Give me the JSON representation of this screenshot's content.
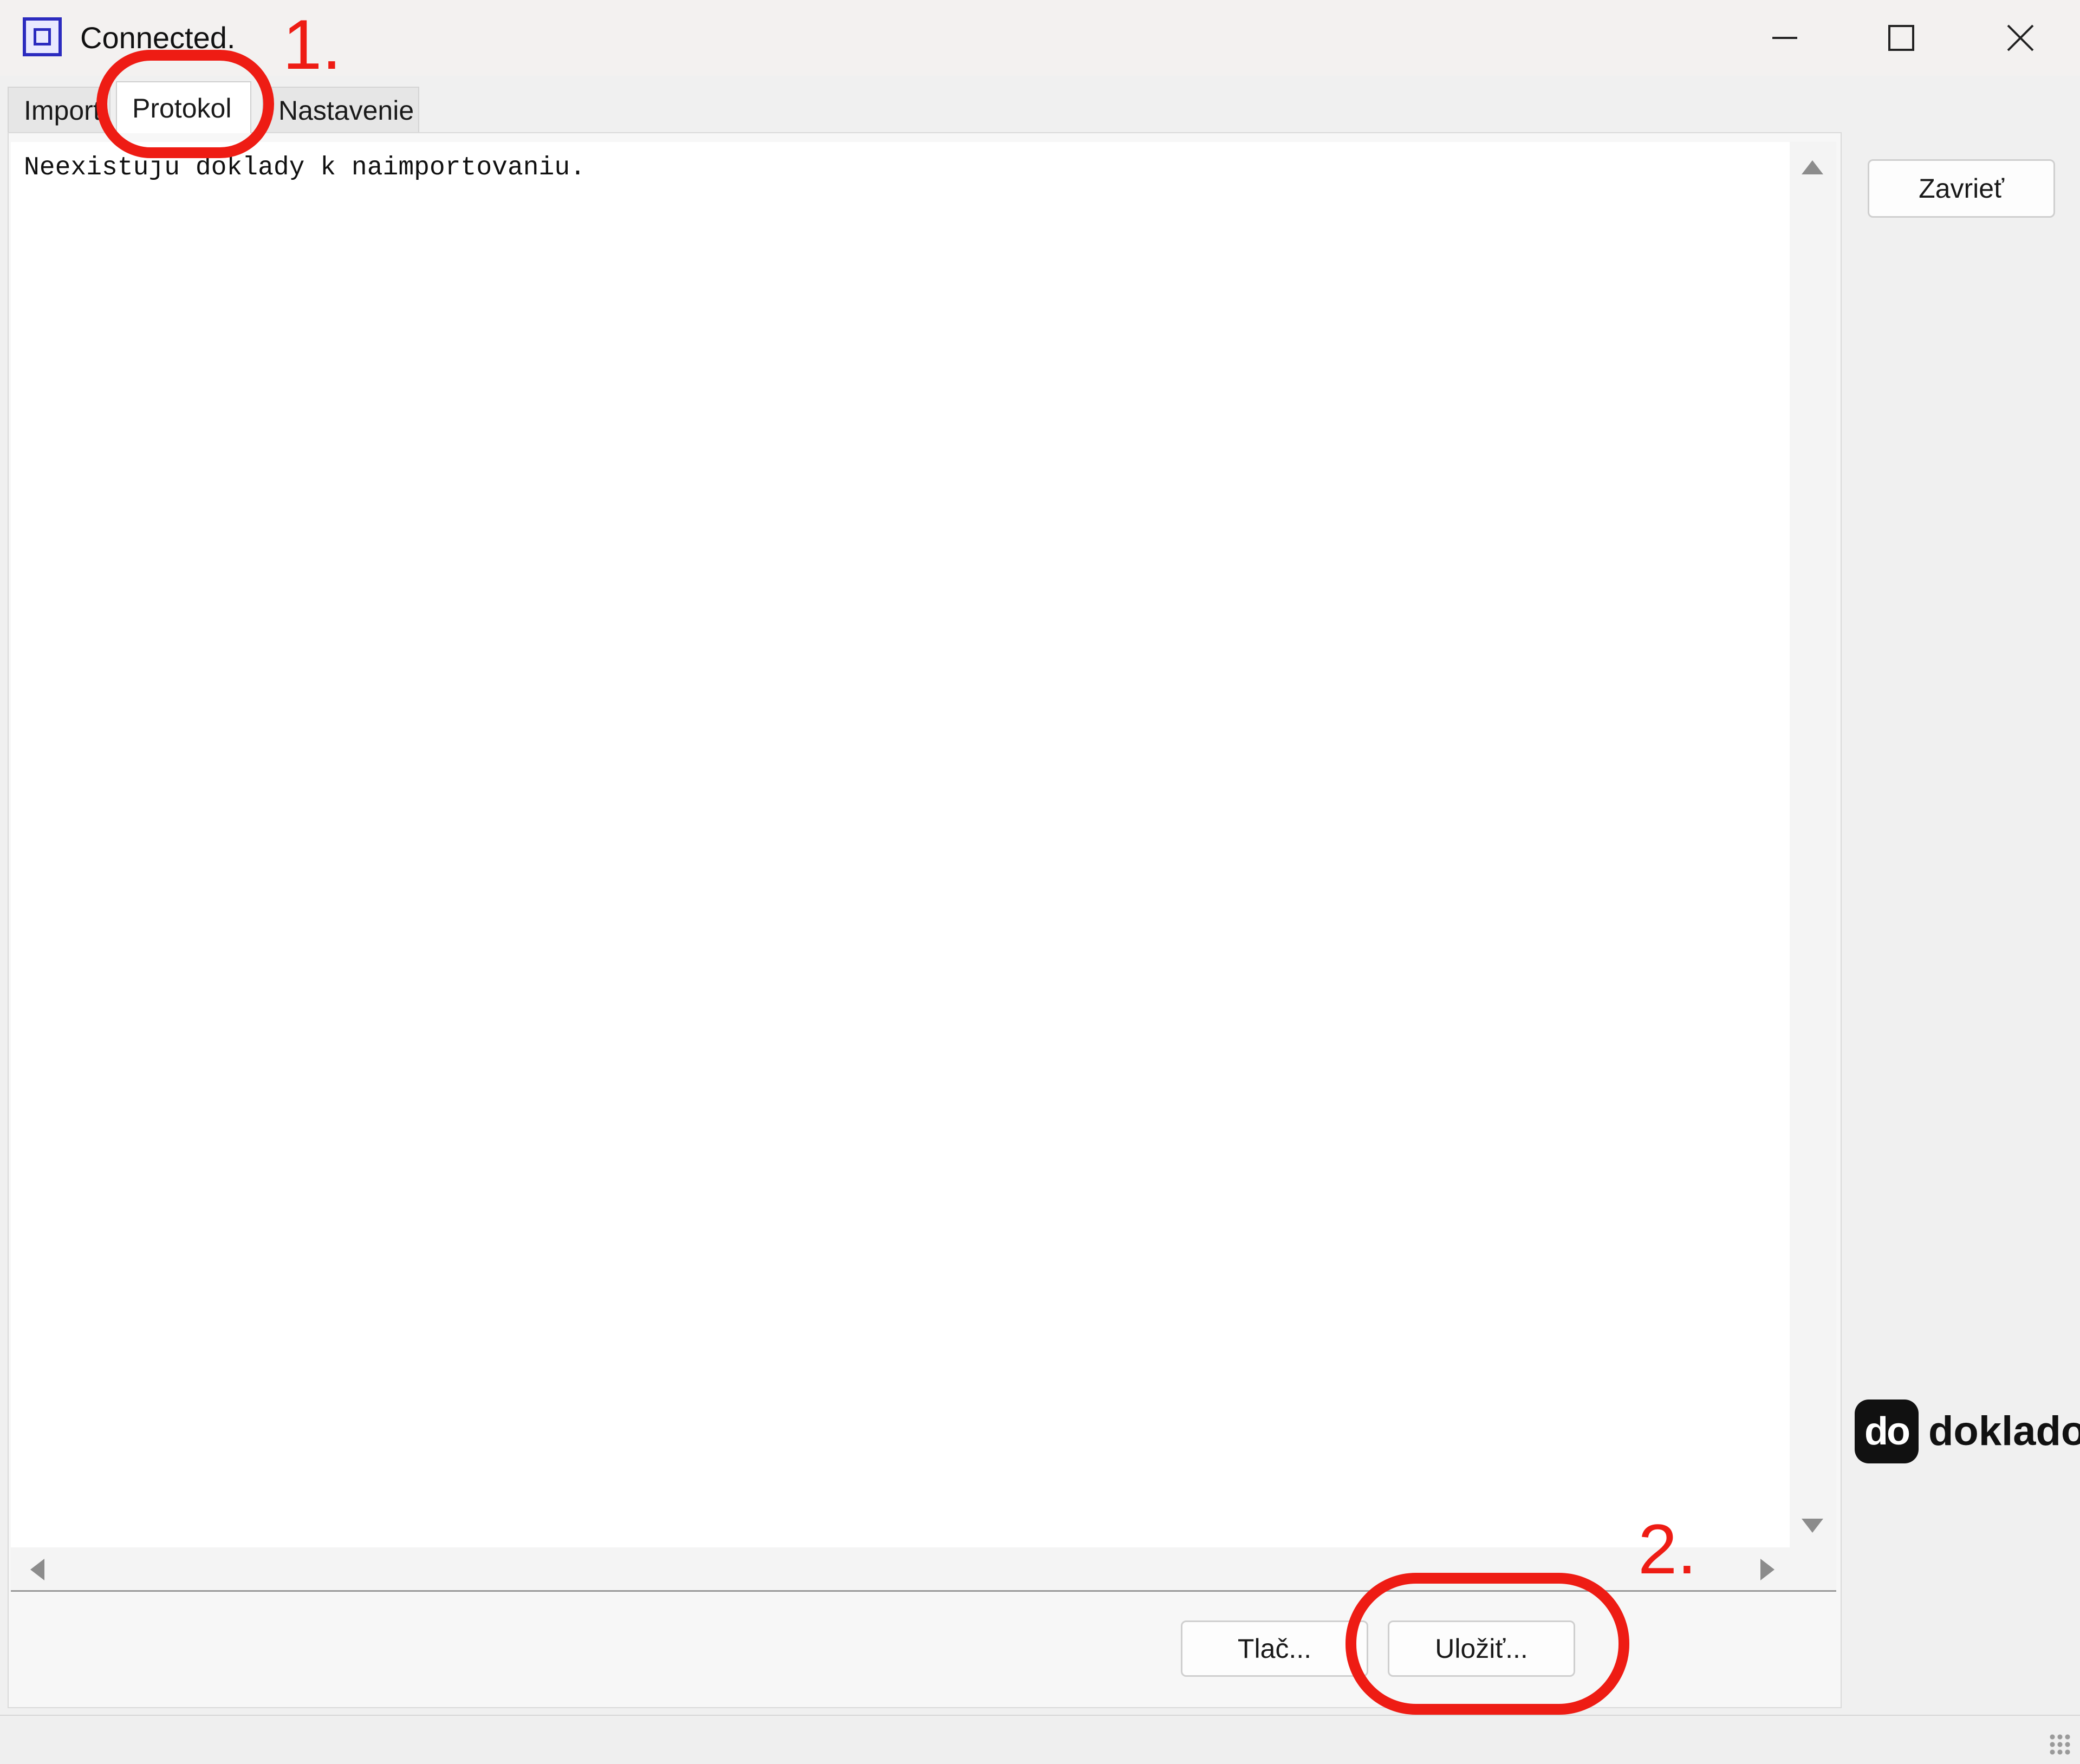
{
  "window": {
    "title": "Connected.",
    "controls": [
      "minimize-icon",
      "maximize-icon",
      "close-icon"
    ]
  },
  "tabs": [
    {
      "label": "Import",
      "active": false
    },
    {
      "label": "Protokol",
      "active": true
    },
    {
      "label": "Nastavenie",
      "active": false
    }
  ],
  "protokol": {
    "log_text": "Neexistuju doklady k naimportovaniu."
  },
  "buttons": {
    "close_label": "Zavrieť",
    "print_label": "Tlač...",
    "save_label": "Uložiť..."
  },
  "logo": {
    "mark": "do",
    "wordmark": "doklado"
  },
  "annotations": {
    "step_1": "1.",
    "step_2": "2.",
    "color": "#ee1c14"
  }
}
